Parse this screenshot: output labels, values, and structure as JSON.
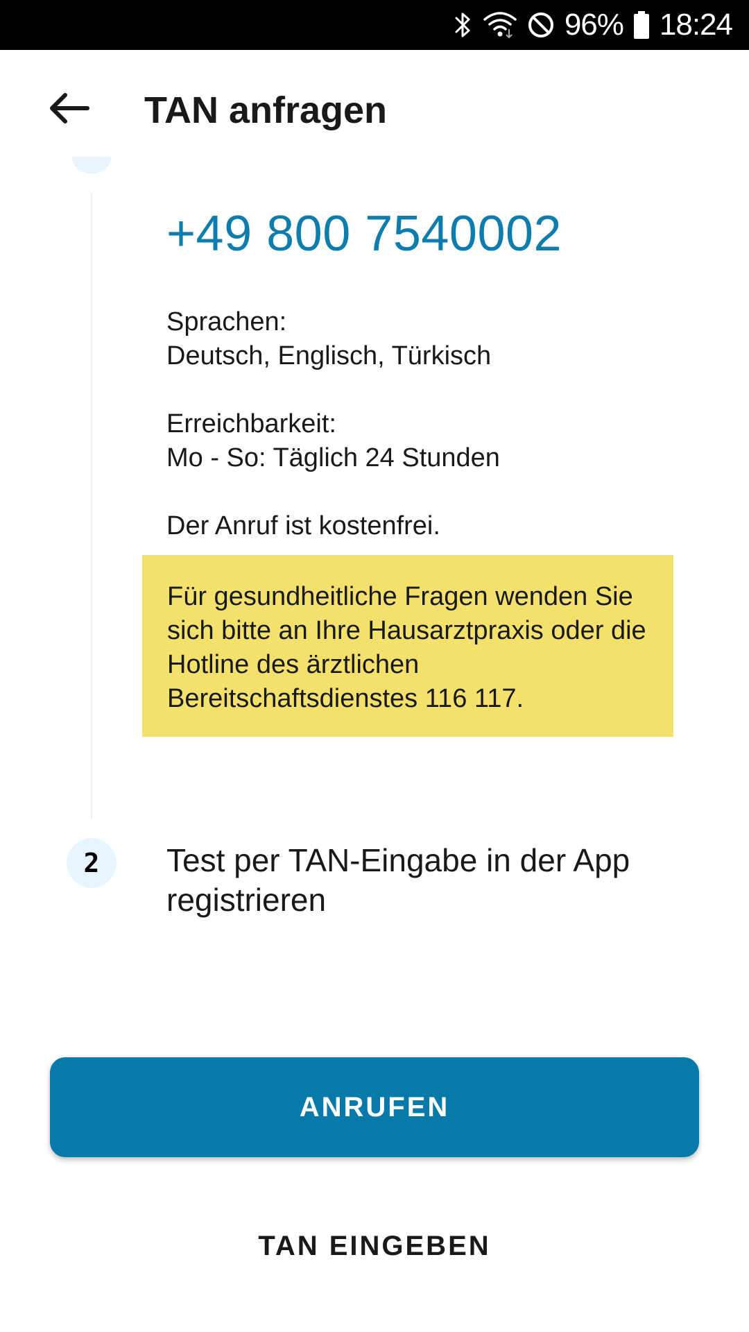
{
  "status_bar": {
    "icons": [
      "bluetooth-icon",
      "wifi-icon",
      "do-not-disturb-icon",
      "battery-icon"
    ],
    "battery_percent": "96%",
    "time": "18:24"
  },
  "app_bar": {
    "back_icon": "arrow-left-icon",
    "title": "TAN anfragen"
  },
  "step1": {
    "phone_number": "+49 800 7540002",
    "languages_label": "Sprachen:",
    "languages_value": "Deutsch, Englisch, Türkisch",
    "availability_label": "Erreichbarkeit:",
    "availability_value": "Mo - So: Täglich 24 Stunden",
    "cost_note": "Der Anruf ist kostenfrei.",
    "health_notice": "Für gesundheitliche Fragen wenden Sie sich bitte an Ihre Hausarztpraxis oder die Hotline des ärztlichen Bereitschaftsdienstes 116 117."
  },
  "step2": {
    "number": "2",
    "label": "Test per TAN-Eingabe in der App registrieren"
  },
  "actions": {
    "call_label": "ANRUFEN",
    "enter_tan_label": "TAN EINGEBEN"
  },
  "colors": {
    "accent": "#077aaa",
    "phone_text": "#0e7cac",
    "notice_background": "#f3e06d",
    "step_circle": "#e8f5ff"
  }
}
